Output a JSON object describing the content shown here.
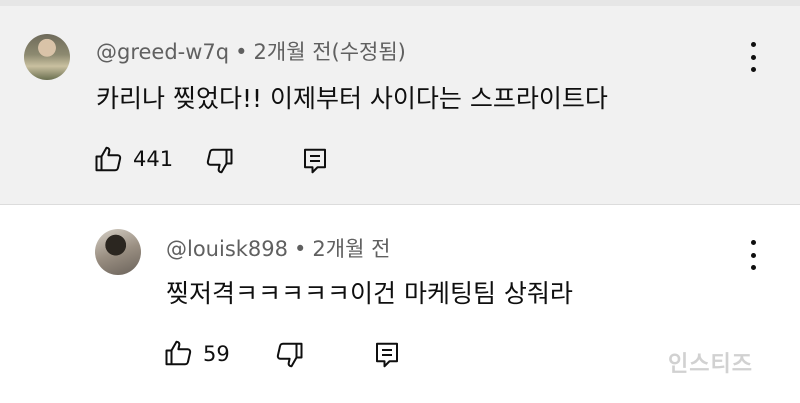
{
  "comment": {
    "username": "@greed-w7q",
    "separator": "•",
    "time": "2개월 전(수정됨)",
    "text": "카리나 찢었다!! 이제부터 사이다는 스프라이트다",
    "likes": "441"
  },
  "reply": {
    "username": "@louisk898",
    "separator": "•",
    "time": "2개월 전",
    "text": "찢저격ㅋㅋㅋㅋㅋ이건 마케팅팀 상줘라",
    "likes": "59"
  },
  "watermark": "인스티즈",
  "icons": [
    "thumbs-up-icon",
    "thumbs-down-icon",
    "reply-icon",
    "more-options-icon"
  ]
}
